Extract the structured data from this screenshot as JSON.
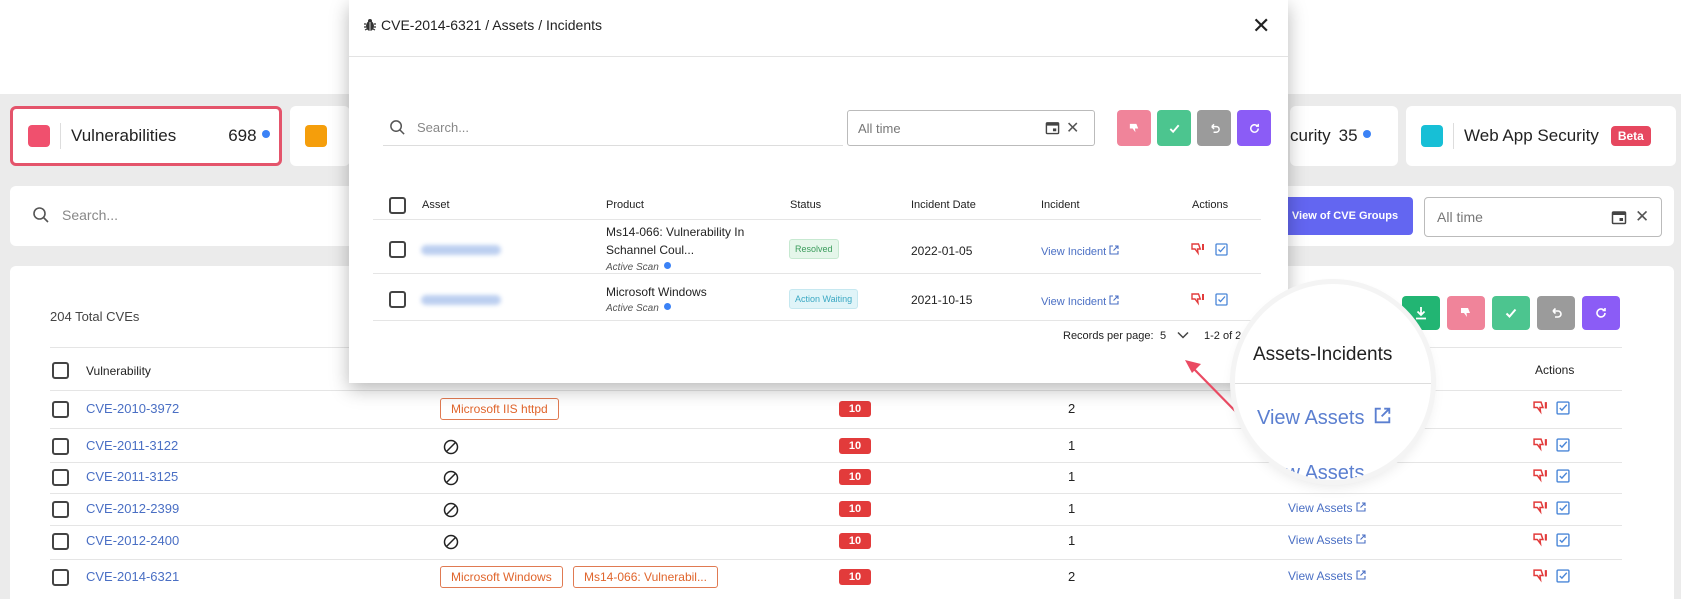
{
  "stats": {
    "vulnerabilities": {
      "label": "Vulnerabilities",
      "count": "698",
      "color": "#f0506e"
    },
    "orange": {
      "color": "#f59e0b"
    },
    "security": {
      "label": "curity",
      "count": "35"
    },
    "webapp": {
      "label": "Web App Security",
      "badge": "Beta",
      "color": "#17bfd6"
    }
  },
  "search": {
    "placeholder": "Search..."
  },
  "toolbar": {
    "cve_groups": "View of CVE Groups",
    "date_filter": "All time"
  },
  "table": {
    "total": "204 Total CVEs",
    "columns": {
      "vulnerability": "Vulnerability",
      "actions": "Actions"
    },
    "rows": [
      {
        "cve": "CVE-2010-3972",
        "products": [
          "Microsoft IIS httpd"
        ],
        "score": "10",
        "count": "2",
        "link": "View Assets"
      },
      {
        "cve": "CVE-2011-3122",
        "products": [],
        "score": "10",
        "count": "1",
        "link": "View Assets"
      },
      {
        "cve": "CVE-2011-3125",
        "products": [],
        "score": "10",
        "count": "1",
        "link": "View Assets"
      },
      {
        "cve": "CVE-2012-2399",
        "products": [],
        "score": "10",
        "count": "1",
        "link": "View Assets"
      },
      {
        "cve": "CVE-2012-2400",
        "products": [],
        "score": "10",
        "count": "1",
        "link": "View Assets"
      },
      {
        "cve": "CVE-2014-6321",
        "products": [
          "Microsoft Windows",
          "Ms14-066: Vulnerabil..."
        ],
        "score": "10",
        "count": "2",
        "link": "View Assets"
      }
    ]
  },
  "modal": {
    "title": "CVE-2014-6321 / Assets / Incidents",
    "search_placeholder": "Search...",
    "date_filter": "All time",
    "columns": {
      "asset": "Asset",
      "product": "Product",
      "status": "Status",
      "date": "Incident Date",
      "incident": "Incident",
      "actions": "Actions"
    },
    "rows": [
      {
        "product": "Ms14-066: Vulnerability In Schannel Coul...",
        "sub": "Active Scan",
        "status": "Resolved",
        "date": "2022-01-05",
        "incident": "View Incident"
      },
      {
        "product": "Microsoft Windows",
        "sub": "Active Scan",
        "status": "Action Waiting",
        "date": "2021-10-15",
        "incident": "View Incident"
      }
    ],
    "footer": {
      "records_label": "Records per page:",
      "per_page": "5",
      "range": "1-2 of 2"
    }
  },
  "magnifier": {
    "header": "Assets-Incidents",
    "link": "View Assets",
    "link2": "View Assets"
  }
}
